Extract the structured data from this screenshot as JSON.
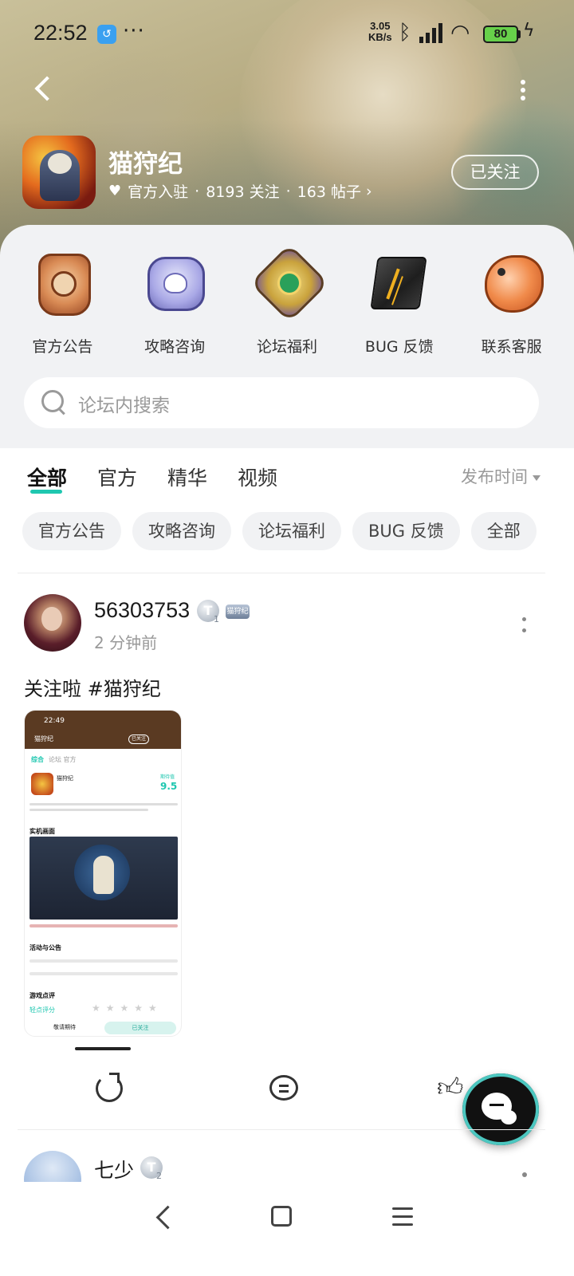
{
  "status_bar": {
    "time": "22:52",
    "app_badge": "↺",
    "dots": "···",
    "net_speed_value": "3.05",
    "net_speed_unit": "KB/s",
    "battery": "80",
    "colors": {
      "battery_fill": "#67d04a"
    }
  },
  "header": {
    "game_title": "猫狩纪",
    "official_label": "官方入驻",
    "followers": "8193 关注",
    "posts": "163 帖子",
    "separator": "·",
    "follow_button": "已关注"
  },
  "shortcuts": [
    {
      "label": "官方公告",
      "icon": "notice-badge-icon"
    },
    {
      "label": "攻略咨询",
      "icon": "paw-badge-icon"
    },
    {
      "label": "论坛福利",
      "icon": "gem-badge-icon"
    },
    {
      "label": "BUG 反馈",
      "icon": "broken-rock-icon"
    },
    {
      "label": "联系客服",
      "icon": "koi-fish-icon"
    }
  ],
  "search": {
    "placeholder": "论坛内搜索"
  },
  "tabs": [
    {
      "label": "全部",
      "active": true
    },
    {
      "label": "官方",
      "active": false
    },
    {
      "label": "精华",
      "active": false
    },
    {
      "label": "视频",
      "active": false
    }
  ],
  "sort": {
    "label": "发布时间"
  },
  "chips": [
    "官方公告",
    "攻略咨询",
    "论坛福利",
    "BUG 反馈",
    "全部"
  ],
  "post1": {
    "username": "56303753",
    "level": "T",
    "level_num": "1",
    "title_badge": "猫狩纪",
    "time": "2 分钟前",
    "text": "关注啦 #猫狩纪",
    "screenshot": {
      "time": "22:49",
      "name": "猫狩纪",
      "follow": "已关注",
      "tab_active": "综合",
      "tab_others": "论坛  官方",
      "game_name": "猫狩纪",
      "score_label": "期待值",
      "score": "9.5",
      "section_real": "实机画面",
      "section_events": "活动与公告",
      "section_reviews": "游戏点评",
      "rate_label": "轻点评分",
      "stars": "★★★★★",
      "wait_label": "敬请期待",
      "followed_label": "已关注"
    }
  },
  "post2": {
    "username": "七少",
    "level": "T",
    "level_num": "2"
  },
  "colors": {
    "accent": "#1fc7b0",
    "chip_bg": "#f1f2f4",
    "panel_bg": "#f1f2f4"
  }
}
